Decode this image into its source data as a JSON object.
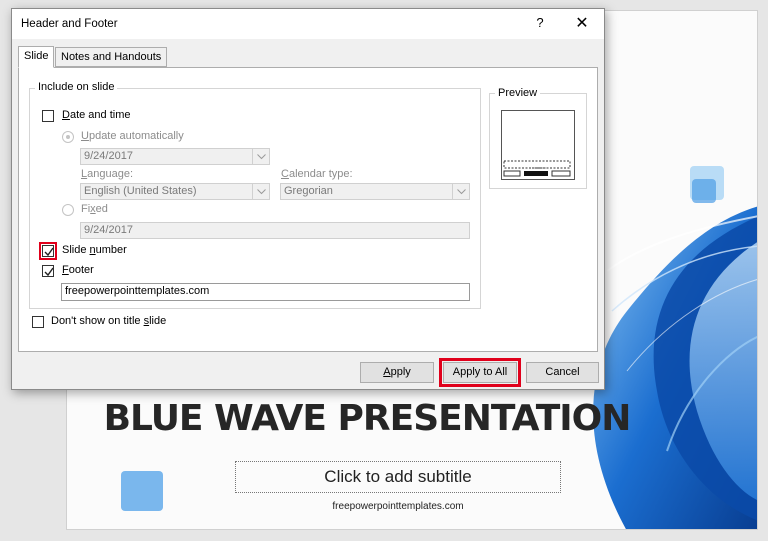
{
  "slide": {
    "title": "BLUE WAVE PRESENTATION",
    "subtitle_placeholder": "Click to add subtitle",
    "footer": "freepowerpointtemplates.com"
  },
  "dialog": {
    "title": "Header and Footer",
    "help_glyph": "?",
    "close_glyph": "✕",
    "tabs": [
      {
        "label": "Slide",
        "active": true
      },
      {
        "label": "Notes and Handouts",
        "active": false
      }
    ],
    "include_group_label": "Include on slide",
    "date_time": {
      "label_pre": "",
      "label_u": "D",
      "label_post": "ate and time",
      "checked": false
    },
    "update_auto": {
      "label_pre": "",
      "label_u": "U",
      "label_post": "pdate automatically",
      "selected": true,
      "enabled": false
    },
    "date_value": "9/24/2017",
    "language_label_pre": "",
    "language_label_u": "L",
    "language_label_post": "anguage:",
    "language_value": "English (United States)",
    "calendar_label_pre": "",
    "calendar_label_u": "C",
    "calendar_label_post": "alendar type:",
    "calendar_value": "Gregorian",
    "fixed": {
      "label_pre": "Fi",
      "label_u": "x",
      "label_post": "ed",
      "selected": false,
      "enabled": false
    },
    "fixed_value": "9/24/2017",
    "slide_number": {
      "label_pre": "Slide ",
      "label_u": "n",
      "label_post": "umber",
      "checked": true
    },
    "footer": {
      "label_pre": "",
      "label_u": "F",
      "label_post": "ooter",
      "checked": true
    },
    "footer_value": "freepowerpointtemplates.com",
    "dont_show_title": {
      "label_pre": "Don't show on title ",
      "label_u": "s",
      "label_post": "lide",
      "checked": false
    },
    "preview_label": "Preview",
    "buttons": {
      "apply_u": "A",
      "apply_post": "pply",
      "apply_all": "Apply to All",
      "cancel": "Cancel"
    }
  },
  "colors": {
    "highlight": "#e0001b",
    "wave_primary": "#0f5bbf",
    "wave_light": "#5aa6ea"
  }
}
